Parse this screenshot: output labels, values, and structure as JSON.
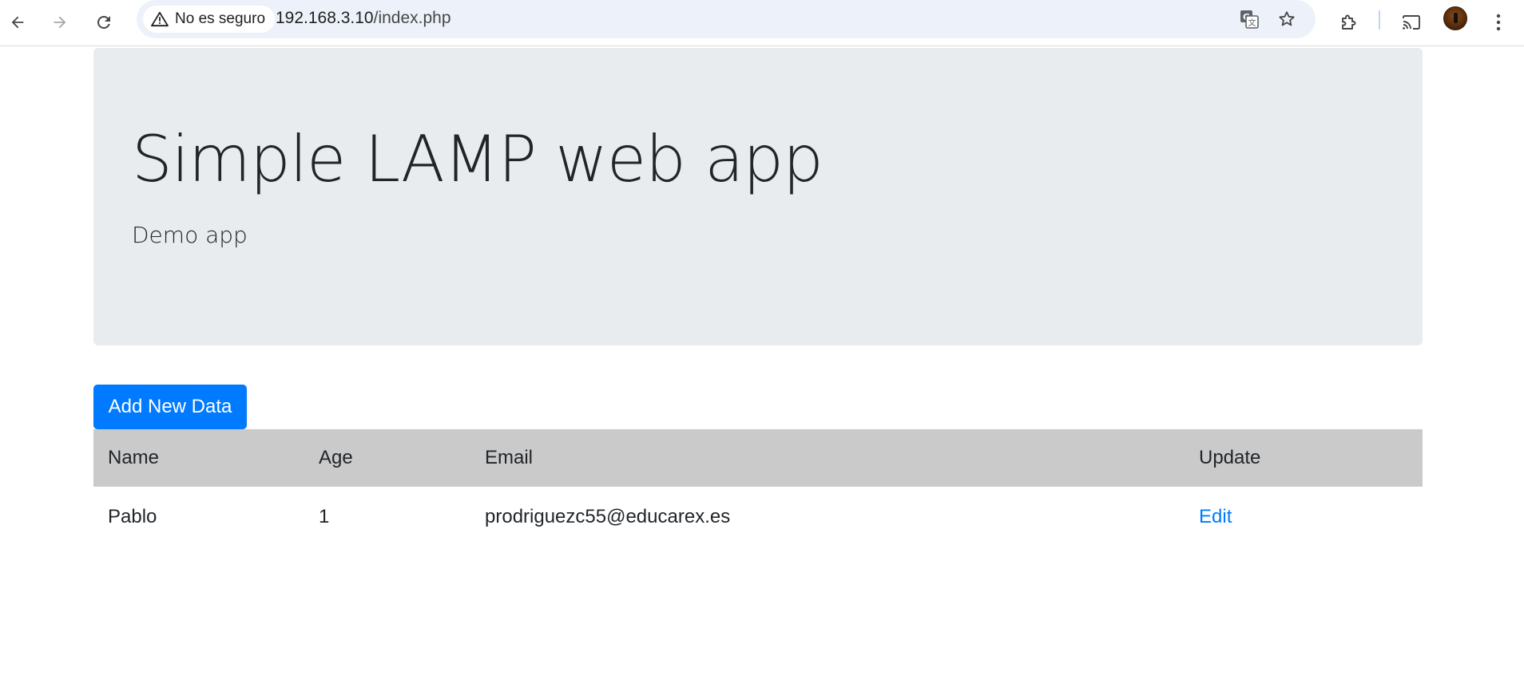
{
  "browser": {
    "security_label": "No es seguro",
    "url_host": "192.168.3.10",
    "url_path": "/index.php",
    "icons": {
      "back": "arrow-left-icon",
      "forward": "arrow-right-icon",
      "reload": "reload-icon",
      "security": "warning-triangle-icon",
      "translate": "translate-icon",
      "bookmark": "star-icon",
      "extensions": "puzzle-icon",
      "cast": "cast-icon",
      "menu": "kebab-menu-icon"
    }
  },
  "jumbotron": {
    "title": "Simple LAMP web app",
    "subtitle": "Demo app",
    "background": "#e9ecef"
  },
  "actions": {
    "add_label": "Add New Data",
    "primary_color": "#007bff"
  },
  "table": {
    "headers": {
      "name": "Name",
      "age": "Age",
      "email": "Email",
      "update": "Update"
    },
    "header_background": "#cacaca",
    "rows": [
      {
        "name": "Pablo",
        "age": "1",
        "email": "prodriguezc55@educarex.es",
        "update": "Edit"
      }
    ]
  }
}
